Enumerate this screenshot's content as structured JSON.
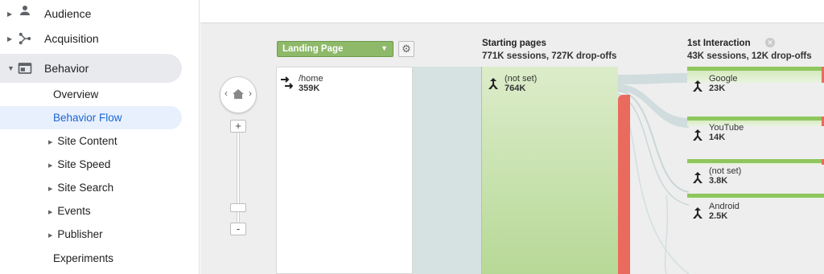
{
  "sidebar": {
    "audience": "Audience",
    "acquisition": "Acquisition",
    "behavior": "Behavior",
    "items": {
      "overview": "Overview",
      "behavior_flow": "Behavior Flow",
      "site_content": "Site Content",
      "site_speed": "Site Speed",
      "site_search": "Site Search",
      "events": "Events",
      "publisher": "Publisher",
      "experiments": "Experiments"
    }
  },
  "flow": {
    "dimension_select": "Landing Page",
    "starting_title": "Starting pages",
    "starting_stats": "771K sessions, 727K drop-offs",
    "interaction_title": "1st Interaction",
    "interaction_stats": "43K sessions, 12K drop-offs",
    "landing_node": {
      "label": "/home",
      "value": "359K"
    },
    "starting_node": {
      "label": "(not set)",
      "value": "764K"
    },
    "interaction_nodes": [
      {
        "label": "Google",
        "value": "23K"
      },
      {
        "label": "YouTube",
        "value": "14K"
      },
      {
        "label": "(not set)",
        "value": "3.8K"
      },
      {
        "label": "Android",
        "value": "2.5K"
      }
    ]
  },
  "colors": {
    "active_nav": "#1967d2",
    "node_green": "#8fc65e",
    "dropoff_red": "#ea6b5e",
    "dropdown_green": "#8db968"
  }
}
